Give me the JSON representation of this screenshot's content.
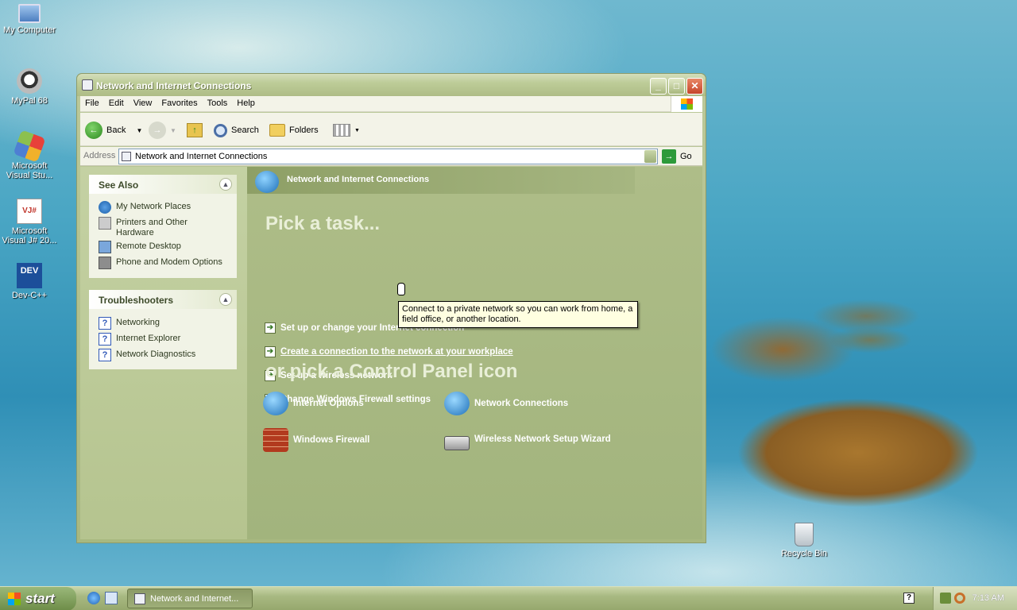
{
  "desktop": {
    "icons": [
      {
        "label": "My Computer"
      },
      {
        "label": "MyPal 68"
      },
      {
        "label": "Microsoft Visual Stu..."
      },
      {
        "label": "Microsoft Visual J# 20..."
      },
      {
        "label": "Dev-C++"
      },
      {
        "label": "Recycle Bin"
      }
    ]
  },
  "window": {
    "title": "Network and Internet Connections",
    "menu": [
      "File",
      "Edit",
      "View",
      "Favorites",
      "Tools",
      "Help"
    ],
    "toolbar": {
      "back": "Back",
      "search": "Search",
      "folders": "Folders"
    },
    "address": {
      "label": "Address",
      "value": "Network and Internet Connections",
      "go": "Go"
    },
    "see_also": {
      "title": "See Also",
      "items": [
        "My Network Places",
        "Printers and Other Hardware",
        "Remote Desktop",
        "Phone and Modem Options"
      ]
    },
    "troubleshooters": {
      "title": "Troubleshooters",
      "items": [
        "Networking",
        "Internet Explorer",
        "Network Diagnostics"
      ]
    },
    "header": "Network and Internet Connections",
    "pick_task": "Pick a task...",
    "tasks": [
      "Set up or change your Internet connection",
      "Create a connection to the network at your workplace",
      "Set up a wireless network",
      "Change Windows Firewall settings"
    ],
    "pick_icon": "or pick a Control Panel icon",
    "cp_icons": [
      "Internet Options",
      "Network Connections",
      "Windows Firewall",
      "Wireless Network Setup Wizard"
    ],
    "tooltip": "Connect to a private network so you can work from home, a field office, or another location."
  },
  "taskbar": {
    "start": "start",
    "task_button": "Network and Internet...",
    "clock": "7:13 AM"
  }
}
